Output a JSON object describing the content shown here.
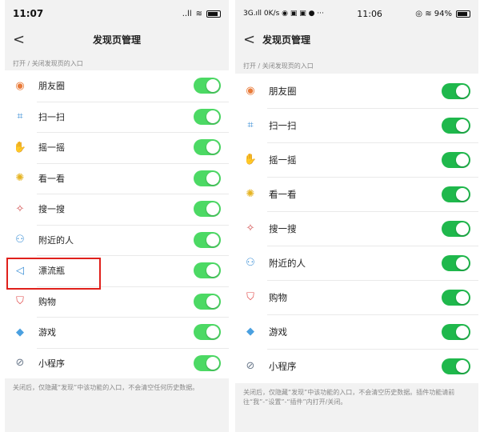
{
  "left": {
    "status": {
      "time": "11:07",
      "signal": "..ll",
      "wifi": "≋"
    },
    "nav": {
      "back": "<",
      "title": "发现页管理"
    },
    "section_label": "打开 / 关闭发现页的入口",
    "items": [
      {
        "label": "朋友圈",
        "icon": "moments-icon",
        "on": true
      },
      {
        "label": "扫一扫",
        "icon": "scan-icon",
        "on": true
      },
      {
        "label": "摇一摇",
        "icon": "shake-icon",
        "on": true
      },
      {
        "label": "看一看",
        "icon": "top-stories-icon",
        "on": true
      },
      {
        "label": "搜一搜",
        "icon": "search-icon",
        "on": true
      },
      {
        "label": "附近的人",
        "icon": "people-nearby-icon",
        "on": true
      },
      {
        "label": "漂流瓶",
        "icon": "drift-bottle-icon",
        "on": true
      },
      {
        "label": "购物",
        "icon": "shopping-icon",
        "on": true
      },
      {
        "label": "游戏",
        "icon": "games-icon",
        "on": true
      },
      {
        "label": "小程序",
        "icon": "mini-program-icon",
        "on": true
      }
    ],
    "footer": "关闭后，仅隐藏“发现”中该功能的入口，不会清空任何历史数据。",
    "highlight_color": "#e0201b"
  },
  "right": {
    "status": {
      "left": "3G.ıll 0K/s ◉ ▣ ▣ ● ···",
      "time": "11:06",
      "right": "◎ ≋ 94%"
    },
    "nav": {
      "back": "<",
      "title": "发现页管理"
    },
    "section_label": "打开 / 关闭发现页的入口",
    "items": [
      {
        "label": "朋友圈",
        "icon": "moments-icon",
        "on": true
      },
      {
        "label": "扫一扫",
        "icon": "scan-icon",
        "on": true
      },
      {
        "label": "摇一摇",
        "icon": "shake-icon",
        "on": true
      },
      {
        "label": "看一看",
        "icon": "top-stories-icon",
        "on": true
      },
      {
        "label": "搜一搜",
        "icon": "search-icon",
        "on": true
      },
      {
        "label": "附近的人",
        "icon": "people-nearby-icon",
        "on": true
      },
      {
        "label": "购物",
        "icon": "shopping-icon",
        "on": true
      },
      {
        "label": "游戏",
        "icon": "games-icon",
        "on": true
      },
      {
        "label": "小程序",
        "icon": "mini-program-icon",
        "on": true
      }
    ],
    "footer": "关闭后，仅隐藏“发现”中该功能的入口，不会清空历史数据。插件功能请前往“我”-“设置”-“插件”内打开/关闭。"
  },
  "colors": {
    "toggle_on_left": "#4cd964",
    "toggle_on_right": "#1fb84c"
  }
}
